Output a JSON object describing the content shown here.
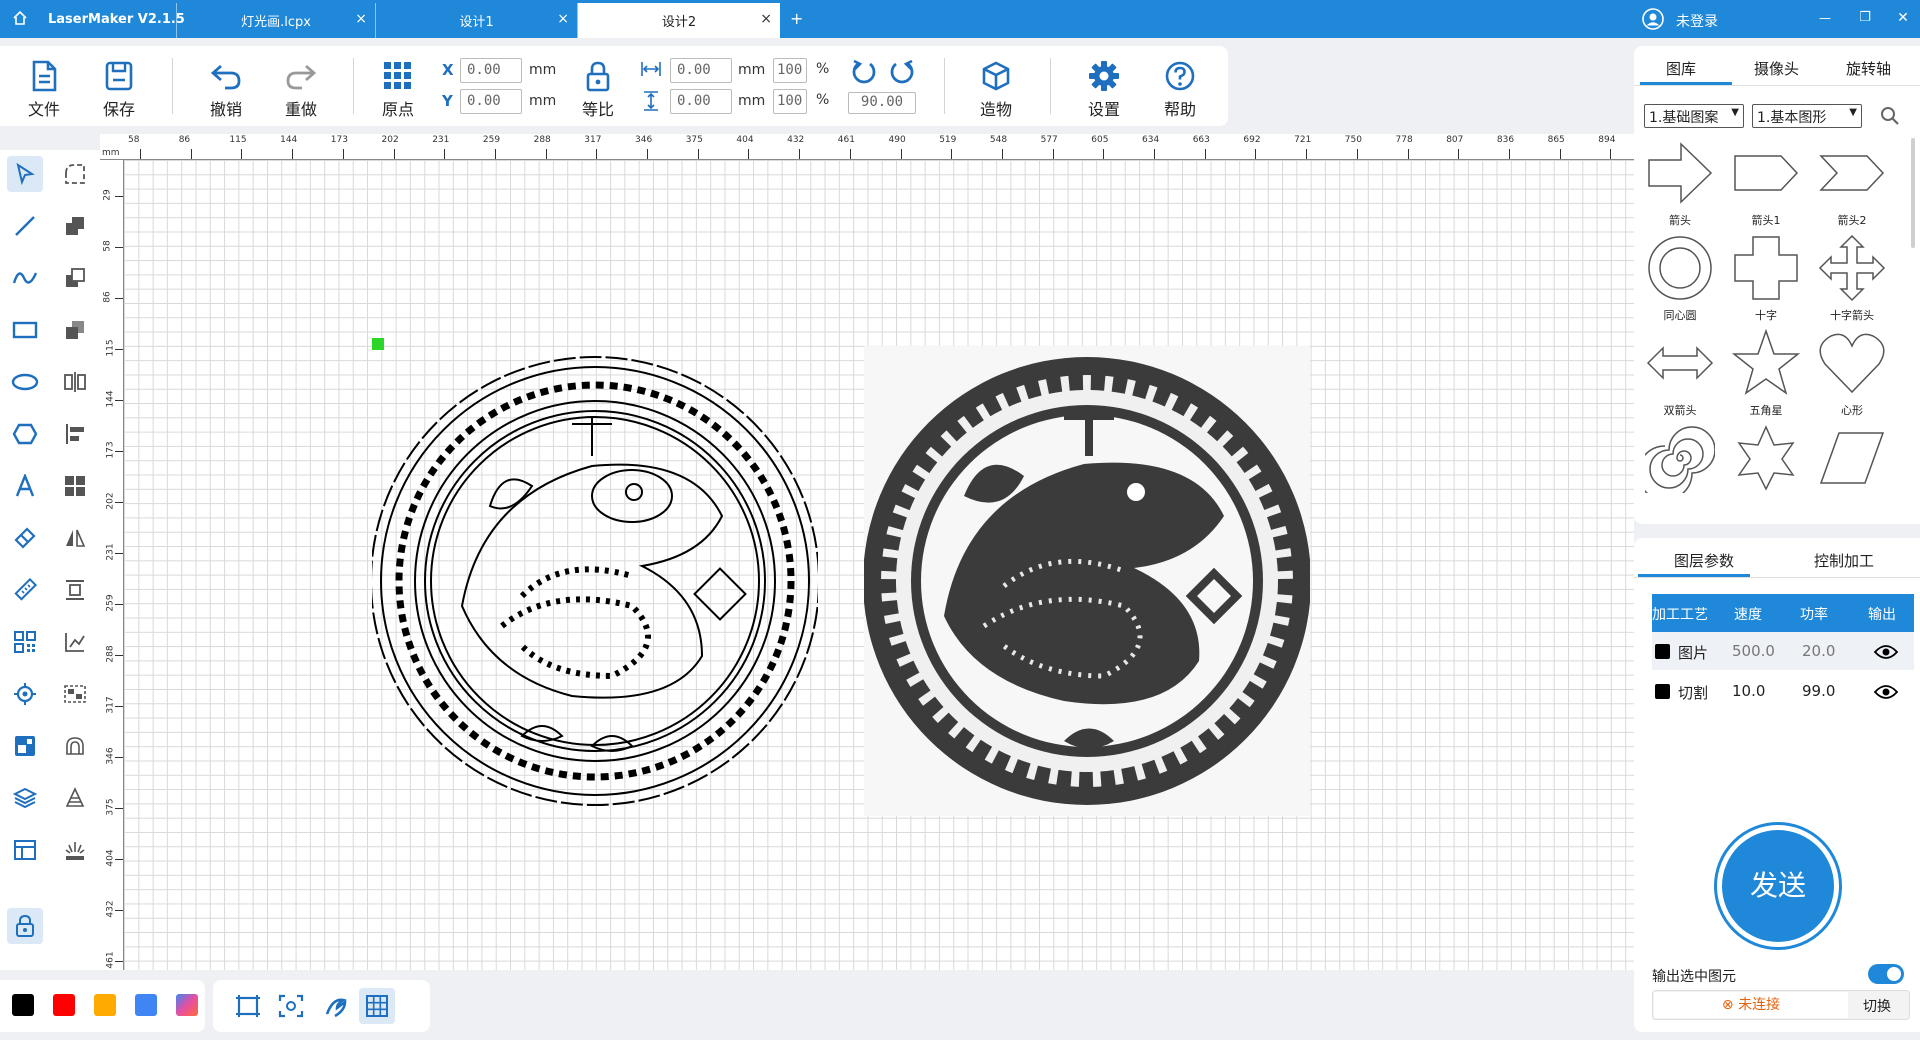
{
  "app": {
    "title": "LaserMaker V2.1.5",
    "user": "未登录"
  },
  "tabs": [
    {
      "label": "灯光画.lcpx",
      "close": "×"
    },
    {
      "label": "设计1",
      "close": "×"
    },
    {
      "label": "设计2",
      "close": "×"
    }
  ],
  "new_tab": "+",
  "window": {
    "minimize": "—",
    "restore": "❐",
    "close": "✕"
  },
  "toolbar": {
    "file": "文件",
    "save": "保存",
    "undo": "撤销",
    "redo": "重做",
    "origin": "原点",
    "x_label": "X",
    "y_label": "Y",
    "x_value": "0.00",
    "y_value": "0.00",
    "unit": "mm",
    "lock": "等比",
    "w_value": "0.00",
    "h_value": "0.00",
    "w_pct": "100",
    "h_pct": "100",
    "pct": "%",
    "rotate_value": "90.00",
    "build": "造物",
    "settings": "设置",
    "help": "帮助"
  },
  "ruler": {
    "unit": "mm",
    "top_ticks": [
      "58",
      "86",
      "115",
      "144",
      "173",
      "202",
      "231",
      "259",
      "288",
      "317",
      "346",
      "375",
      "404",
      "432",
      "461",
      "490",
      "519",
      "548",
      "577",
      "605",
      "634",
      "663",
      "692",
      "721",
      "750",
      "778",
      "807",
      "836",
      "865",
      "894"
    ],
    "left_ticks": [
      "29",
      "58",
      "86",
      "115",
      "144",
      "173",
      "202",
      "231",
      "259",
      "288",
      "317",
      "346",
      "375",
      "404",
      "432",
      "461"
    ]
  },
  "library": {
    "tabs": [
      "图库",
      "摄像头",
      "旋转轴"
    ],
    "dropdown1": "1.基础图案",
    "dropdown2": "1.基本图形",
    "shapes": [
      "箭头",
      "箭头1",
      "箭头2",
      "同心圆",
      "十字",
      "十字箭头",
      "双箭头",
      "五角星",
      "心形",
      "",
      "",
      ""
    ]
  },
  "layers": {
    "tabs": [
      "图层参数",
      "控制加工"
    ],
    "headers": [
      "加工工艺",
      "速度",
      "功率",
      "输出"
    ],
    "rows": [
      {
        "color": "#000000",
        "name": "图片",
        "speed": "500.0",
        "power": "20.0"
      },
      {
        "color": "#000000",
        "name": "切割",
        "speed": "10.0",
        "power": "99.0"
      }
    ],
    "send": "发送",
    "output_selected": "输出选中图元",
    "status": "未连接",
    "switch": "切换"
  },
  "swatches": [
    "#000000",
    "#ff0000",
    "#ffaa00",
    "#3f86f4",
    "#e64fa0"
  ],
  "colors": {
    "accent": "#1f88d8",
    "selected_green": "#2bd62b"
  }
}
